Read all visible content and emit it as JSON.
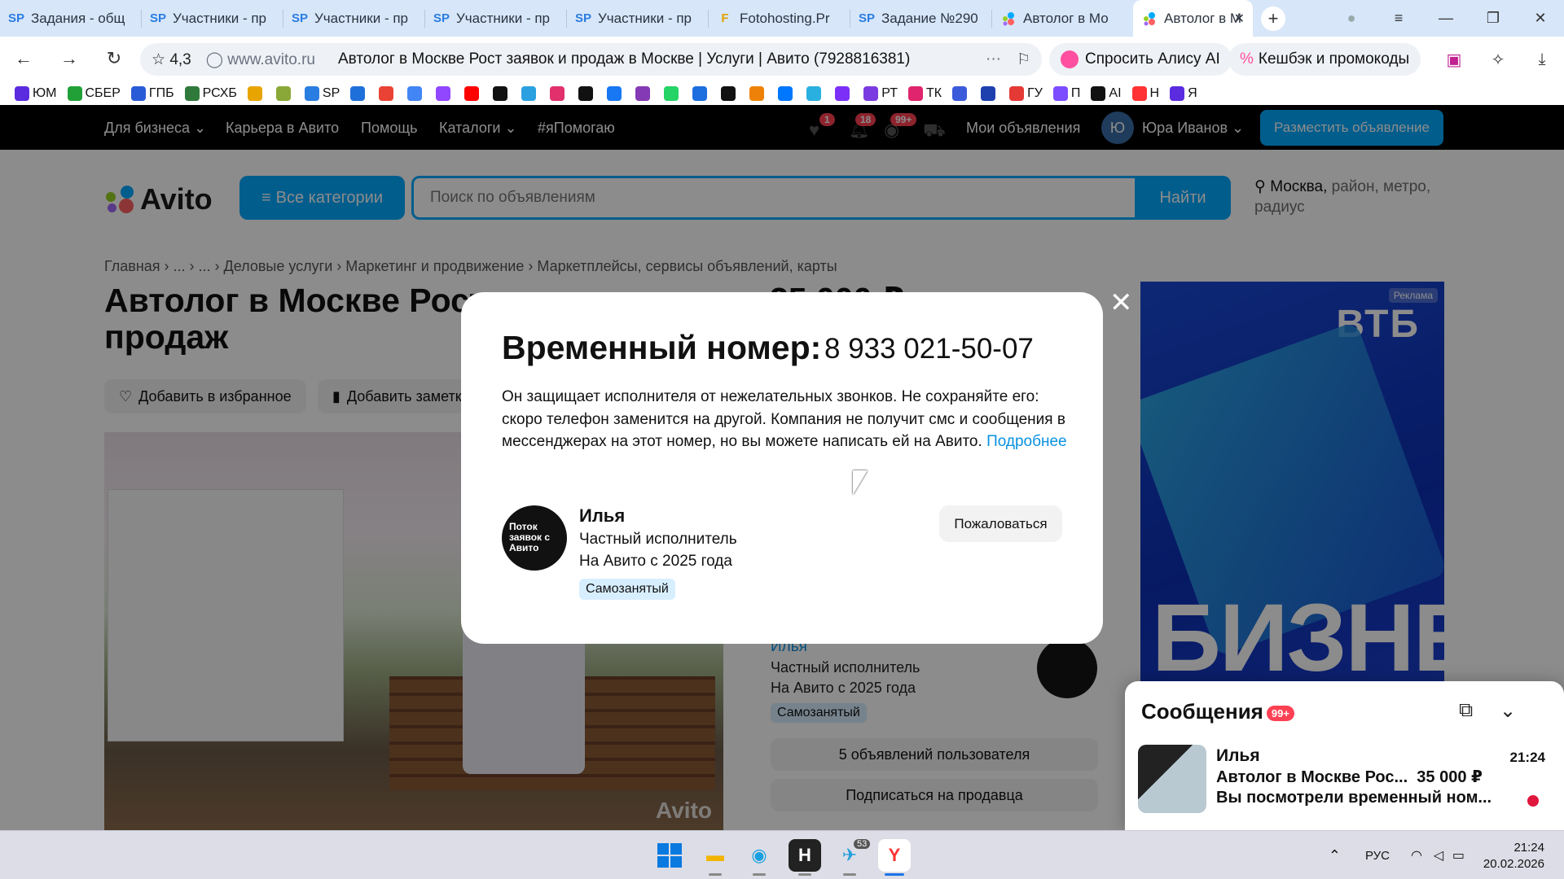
{
  "browser": {
    "tabs": [
      {
        "icon": "sp",
        "label": "Задания - общ"
      },
      {
        "icon": "sp",
        "label": "Участники - пр"
      },
      {
        "icon": "sp",
        "label": "Участники - пр"
      },
      {
        "icon": "sp",
        "label": "Участники - пр"
      },
      {
        "icon": "sp",
        "label": "Участники - пр"
      },
      {
        "icon": "f",
        "label": "Fotohosting.Pr"
      },
      {
        "icon": "sp",
        "label": "Задание №290"
      },
      {
        "icon": "avito",
        "label": "Автолог в Мо"
      },
      {
        "icon": "avito",
        "label": "Автолог в М"
      }
    ],
    "rating": "4,3",
    "domain": "www.avito.ru",
    "page_title": "Автолог в Москве Рост заявок и продаж в Москве | Услуги | Авито (7928816381)",
    "alice_button": "Спросить Алису AI",
    "cashback_button": "Кешбэк и промокоды",
    "bookmarks": [
      "ЮМ",
      "СБЕР",
      "ГПБ",
      "РСХБ",
      "",
      "",
      "SP",
      "",
      "",
      "",
      "",
      "",
      "",
      "",
      "",
      "",
      "",
      "",
      "",
      "",
      "",
      "",
      "",
      "",
      "",
      "РТ",
      "ТК",
      "",
      "",
      "ГУ",
      "П",
      "AI",
      "Н",
      "Я"
    ]
  },
  "avito": {
    "nav": {
      "for_business": "Для бизнеса",
      "career": "Карьера в Авито",
      "help": "Помощь",
      "catalogs": "Каталоги",
      "help_tag": "#яПомогаю",
      "fav_badge": "1",
      "notif_badge": "18",
      "msg_badge": "99+",
      "my_ads": "Мои объявления",
      "user_initial": "Ю",
      "user_name": "Юра Иванов",
      "post_ad": "Разместить объявление"
    },
    "logo": "Avito",
    "all_categories": "Все категории",
    "search_placeholder": "Поиск по объявлениям",
    "search_button": "Найти",
    "location_city": "Москва,",
    "location_rest": " район, метро, радиус",
    "breadcrumb": "Главная › ... › ... › Деловые услуги › Маркетинг и продвижение › Маркетплейсы, сервисы объявлений, карты",
    "title": "Автолог в Москве Рост заявок и продаж",
    "price_peek": "35 000 ₽",
    "add_favorite": "Добавить в избранное",
    "add_note": "Добавить заметку",
    "photo_watermark": "Avito",
    "seller": {
      "name": "Илья",
      "type": "Частный исполнитель",
      "since": "На Авито с 2025 года",
      "tag": "Самозанятый"
    },
    "user_ads_button": "5 объявлений пользователя",
    "subscribe_button": "Подписаться на продавца",
    "ad": {
      "label": "Реклама",
      "brand": "ВТБ",
      "text": "БИЗНЕС"
    }
  },
  "modal": {
    "title": "Временный номер:",
    "phone": "8 933 021-50-07",
    "text": "Он защищает исполнителя от нежелательных звонков. Не сохраняйте его: скоро телефон заменится на другой. Компания не получит смс и сообщения в мессенджерах на этот номер, но вы можете написать ей на Авито.",
    "more_link": "Подробнее",
    "avatar_text": "Поток заявок с Авито",
    "report": "Пожаловаться"
  },
  "messages": {
    "title": "Сообщения",
    "badge": "99+",
    "item": {
      "name": "Илья",
      "time": "21:24",
      "subject": "Автолог в Москве Рос...",
      "price": "35 000 ₽",
      "preview": "Вы посмотрели временный ном..."
    }
  },
  "taskbar": {
    "telegram_badge": "53",
    "lang": "РУС",
    "time": "21:24",
    "date": "20.02.2026"
  }
}
